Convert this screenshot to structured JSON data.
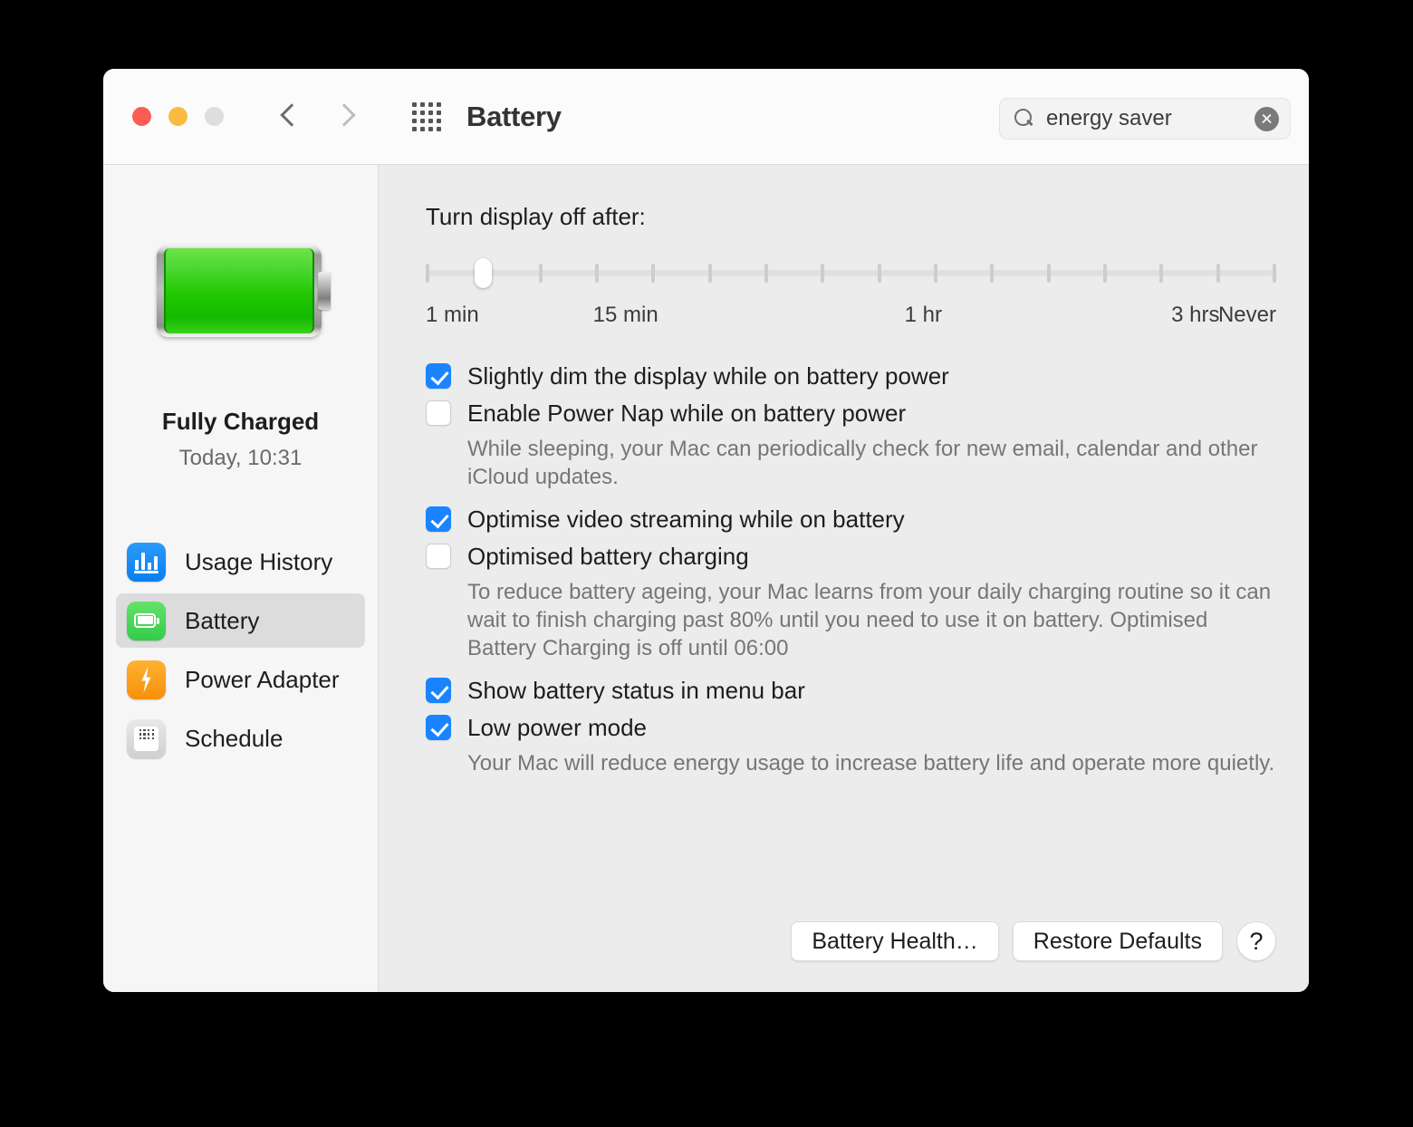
{
  "window": {
    "title": "Battery",
    "traffic_lights": [
      "close",
      "minimise",
      "zoom"
    ],
    "colors": {
      "close": "#fb5c53",
      "minimise": "#f9bc40",
      "zoom": "#dedede",
      "accent_blue": "#1a84ff",
      "sidebar_bg": "#f6f6f6",
      "content_bg": "#ececec",
      "titlebar_bg": "#fbfbfb"
    }
  },
  "search": {
    "value": "energy saver",
    "placeholder": "Search",
    "icon": "search-icon",
    "clear_icon": "clear-icon"
  },
  "toolbar": {
    "back_icon": "chevron-left-icon",
    "forward_icon": "chevron-right-icon",
    "show_all_icon": "grid-icon"
  },
  "sidebar": {
    "battery_icon": "battery-full-icon",
    "charge_state": "Fully Charged",
    "charge_time": "Today, 10:31",
    "items": [
      {
        "label": "Usage History",
        "icon": "usage-history-icon",
        "selected": false
      },
      {
        "label": "Battery",
        "icon": "battery-icon",
        "selected": true
      },
      {
        "label": "Power Adapter",
        "icon": "power-adapter-icon",
        "selected": false
      },
      {
        "label": "Schedule",
        "icon": "schedule-icon",
        "selected": false
      }
    ]
  },
  "main": {
    "slider": {
      "label": "Turn display off after:",
      "tick_count": 16,
      "value_index": 1,
      "scale_labels": [
        {
          "text": "1 min",
          "pos_pct": 0
        },
        {
          "text": "15 min",
          "pos_pct": 23.5
        },
        {
          "text": "1 hr",
          "pos_pct": 58.5
        },
        {
          "text": "3 hrs",
          "pos_pct": 90.5
        },
        {
          "text": "Never",
          "pos_pct": 100
        }
      ]
    },
    "options": [
      {
        "label": "Slightly dim the display while on battery power",
        "checked": true,
        "description": ""
      },
      {
        "label": "Enable Power Nap while on battery power",
        "checked": false,
        "description": "While sleeping, your Mac can periodically check for new email, calendar and other iCloud updates."
      },
      {
        "label": "Optimise video streaming while on battery",
        "checked": true,
        "description": ""
      },
      {
        "label": "Optimised battery charging",
        "checked": false,
        "description": "To reduce battery ageing, your Mac learns from your daily charging routine so it can wait to finish charging past 80% until you need to use it on battery. Optimised Battery Charging is off until 06:00"
      },
      {
        "label": "Show battery status in menu bar",
        "checked": true,
        "description": ""
      },
      {
        "label": "Low power mode",
        "checked": true,
        "description": "Your Mac will reduce energy usage to increase battery life and operate more quietly."
      }
    ],
    "footer": {
      "battery_health": "Battery Health…",
      "restore_defaults": "Restore Defaults",
      "help": "?"
    }
  }
}
